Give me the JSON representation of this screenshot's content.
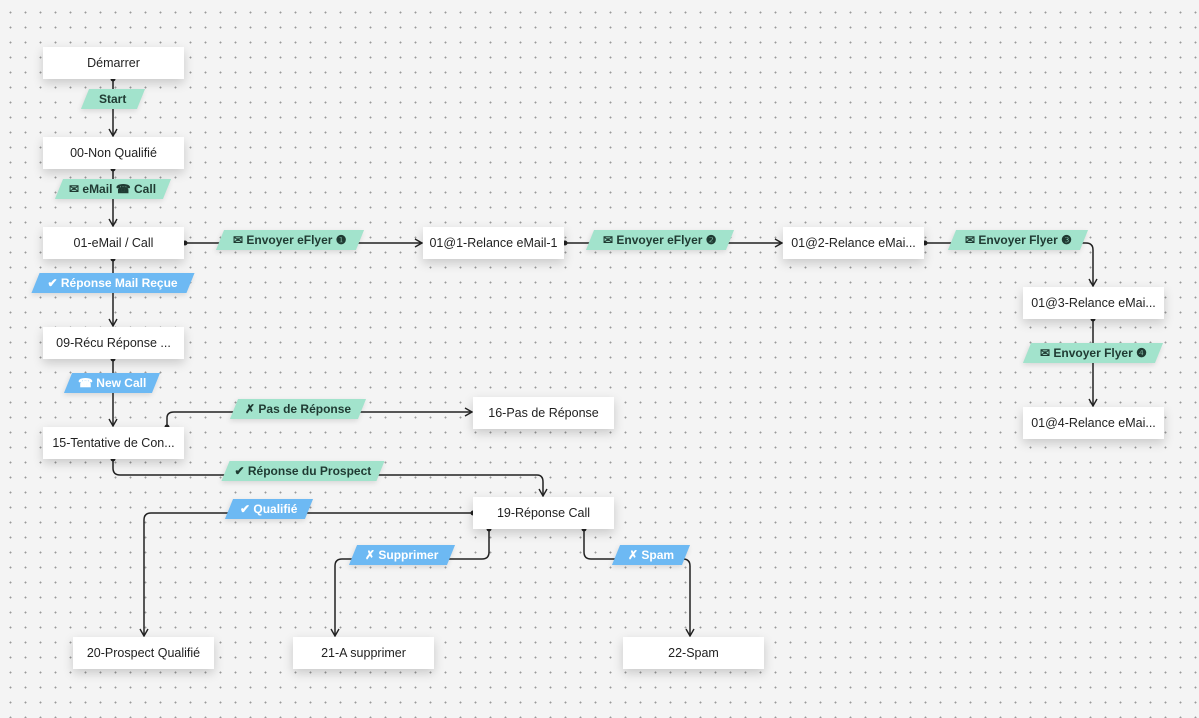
{
  "colors": {
    "teal": "#a2e3cc",
    "blue": "#6db9f3",
    "edge": "#222222"
  },
  "nodes": {
    "demarrer": "Démarrer",
    "non_qualifie": "00-Non Qualifié",
    "email_call": "01-eMail / Call",
    "recu_reponse": "09-Récu Réponse ...",
    "tentative": "15-Tentative de Con...",
    "relance1": "01@1-Relance eMail-1",
    "relance2": "01@2-Relance eMai...",
    "relance3": "01@3-Relance eMai...",
    "relance4": "01@4-Relance eMai...",
    "pas_reponse": "16-Pas de Réponse",
    "reponse_call": "19-Réponse Call",
    "prospect_qualifie": "20-Prospect Qualifié",
    "a_supprimer": "21-A supprimer",
    "spam": "22-Spam"
  },
  "transitions": {
    "start": "Start",
    "email_call": "✉ eMail ☎ Call",
    "eflyer1": "✉ Envoyer eFlyer ❶",
    "reponse_mail": "✔ Réponse Mail Reçue",
    "new_call": "☎ New Call",
    "eflyer2": "✉ Envoyer eFlyer ❷",
    "flyer3": "✉ Envoyer Flyer ❸",
    "flyer4": "✉ Envoyer Flyer ❹",
    "pas_reponse": "✗ Pas de Réponse",
    "reponse_prospect": "✔ Réponse du Prospect",
    "qualifie": "✔ Qualifié",
    "supprimer": "✗ Supprimer",
    "spam": "✗ Spam"
  }
}
